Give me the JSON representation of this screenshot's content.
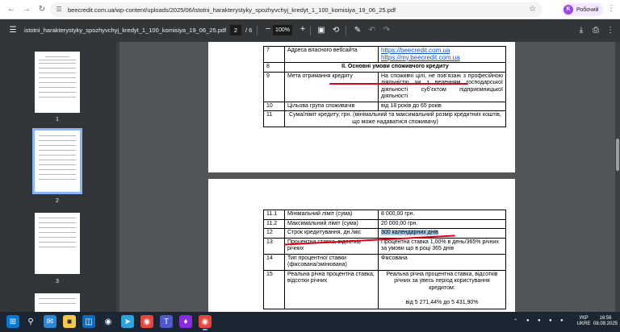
{
  "browser": {
    "url": "beecredit.com.ua/wp-content/uploads/2025/06/istotni_harakterystyky_spozhyvchyj_kredyt_1_100_komisiya_19_06_25.pdf",
    "profile_initial": "K",
    "profile_label": "Робочий"
  },
  "pdf_toolbar": {
    "title": "istotni_harakterystyky_spozhyvchyj_kredyt_1_100_komisiya_19_06_25.pdf",
    "current_page": "2",
    "total_pages": "/  6",
    "zoom": "100%"
  },
  "sidebar": {
    "thumbnails": [
      {
        "label": "1"
      },
      {
        "label": "2"
      },
      {
        "label": "3"
      }
    ]
  },
  "page1": {
    "rows": [
      {
        "num": "7",
        "name": "Адреса власного вебсайта",
        "links": [
          "https://beecredit.com.ua",
          "https://my.beecredit.com.ua"
        ]
      },
      {
        "num": "8",
        "section": "II. Основні умови споживчого кредиту"
      },
      {
        "num": "9",
        "name": "Мета отримання кредиту",
        "value": "На споживчі цілі, не пов’язані з професійною діяльністю чи з веденням господарської діяльності суб’єктом підприємницької діяльності"
      },
      {
        "num": "10",
        "name": "Цільова група споживачів",
        "value": "від 18 років до 65 років"
      },
      {
        "num": "11",
        "name": "Сума/ліміт кредиту, грн. (мінімальний та максимальний розмір кредитних коштів, що може надаватися споживачу)"
      }
    ]
  },
  "page2": {
    "rows": [
      {
        "num": "11.1",
        "name": "Мінімальний ліміт (сума)",
        "value": "8 000,00 грн."
      },
      {
        "num": "11.2",
        "name": "Максимальний ліміт (сума)",
        "value": "20 000,00 грн."
      },
      {
        "num": "12",
        "name": "Строк кредитування, дн./міс",
        "value": "300 календарних днів"
      },
      {
        "num": "13",
        "name": "Процентна ставка, відсотків річних",
        "value": "Процентна ставка 1,00% в день/365% річних за умови що в році 365 днів"
      },
      {
        "num": "14",
        "name": "Тип процентної ставки (фіксована/змінювана)",
        "value": "Фіксована"
      },
      {
        "num": "15",
        "name": "Реальна річна процентна ставка, відсотки річних",
        "value": "Реальна річна процентна ставка, відсотків річних за увесь період користування кредитом:",
        "value2": "від 5 271,44% до 5 431,90%"
      }
    ]
  },
  "taskbar": {
    "lang_top": "УКР",
    "lang_bottom": "UKRE",
    "time": "16:56",
    "date": "08.09.2025"
  },
  "colors": {
    "highlight": "#a6c8ea",
    "annotation_red": "#e0001b",
    "link": "#1155cc",
    "toolbar": "#323639"
  }
}
